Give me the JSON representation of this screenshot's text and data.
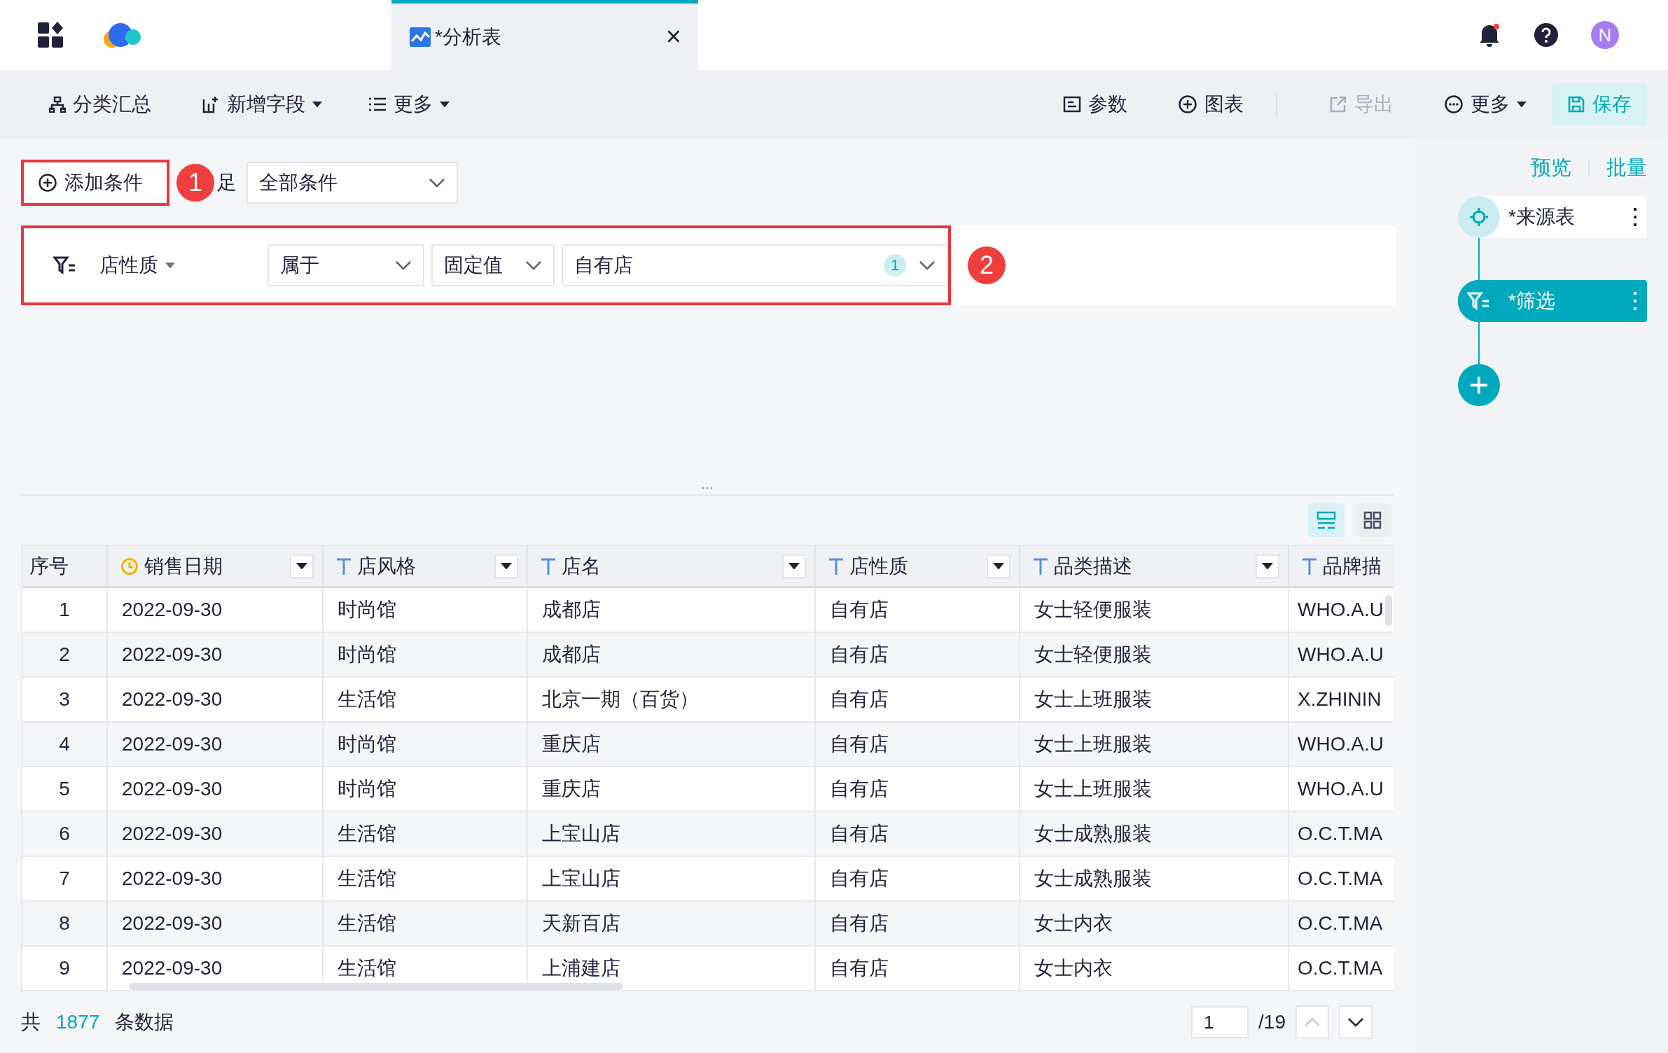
{
  "top_bar": {
    "tab": {
      "title": "*分析表",
      "close": "×",
      "selected": true
    },
    "avatar": "N"
  },
  "toolbar": {
    "left": [
      {
        "label": "分类汇总",
        "dropdown": false
      },
      {
        "label": "新增字段",
        "dropdown": true
      },
      {
        "label": "更多",
        "dropdown": true
      }
    ],
    "right": [
      {
        "label": "参数",
        "kind": "plain",
        "disabled": false,
        "dropdown": false
      },
      {
        "label": "图表",
        "kind": "plain",
        "disabled": false,
        "dropdown": false
      },
      {
        "label": "导出",
        "kind": "plain",
        "disabled": true,
        "dropdown": false
      },
      {
        "label": "更多",
        "kind": "plain",
        "disabled": false,
        "dropdown": true
      },
      {
        "label": "保存",
        "kind": "primary",
        "disabled": false,
        "dropdown": false
      }
    ]
  },
  "filter": {
    "add_button": "添加条件",
    "match_label": "足",
    "match_select": "全部条件",
    "condition": {
      "field": "店性质",
      "operator": "属于",
      "value_type": "固定值",
      "value": "自有店",
      "count": "1"
    },
    "annotations": [
      {
        "number": "1"
      },
      {
        "number": "2"
      }
    ]
  },
  "view_toggles": [
    {
      "selected": true
    },
    {
      "selected": false
    }
  ],
  "table": {
    "columns": [
      {
        "label": "序号",
        "kind": "plain"
      },
      {
        "label": "销售日期",
        "kind": "date"
      },
      {
        "label": "店风格",
        "kind": "text"
      },
      {
        "label": "店名",
        "kind": "text"
      },
      {
        "label": "店性质",
        "kind": "text"
      },
      {
        "label": "品类描述",
        "kind": "text"
      },
      {
        "label": "品牌描",
        "kind": "text"
      }
    ],
    "rows": [
      [
        "1",
        "2022-09-30",
        "时尚馆",
        "成都店",
        "自有店",
        "女士轻便服装",
        "WHO.A.U"
      ],
      [
        "2",
        "2022-09-30",
        "时尚馆",
        "成都店",
        "自有店",
        "女士轻便服装",
        "WHO.A.U"
      ],
      [
        "3",
        "2022-09-30",
        "生活馆",
        "北京一期（百货）",
        "自有店",
        "女士上班服装",
        "X.ZHININ"
      ],
      [
        "4",
        "2022-09-30",
        "时尚馆",
        "重庆店",
        "自有店",
        "女士上班服装",
        "WHO.A.U"
      ],
      [
        "5",
        "2022-09-30",
        "时尚馆",
        "重庆店",
        "自有店",
        "女士上班服装",
        "WHO.A.U"
      ],
      [
        "6",
        "2022-09-30",
        "生活馆",
        "上宝山店",
        "自有店",
        "女士成熟服装",
        "O.C.T.MA"
      ],
      [
        "7",
        "2022-09-30",
        "生活馆",
        "上宝山店",
        "自有店",
        "女士成熟服装",
        "O.C.T.MA"
      ],
      [
        "8",
        "2022-09-30",
        "生活馆",
        "天新百店",
        "自有店",
        "女士内衣",
        "O.C.T.MA"
      ],
      [
        "9",
        "2022-09-30",
        "生活馆",
        "上浦建店",
        "自有店",
        "女士内衣",
        "O.C.T.MA"
      ]
    ]
  },
  "footer": {
    "prefix": "共",
    "count": "1877",
    "suffix": "条数据",
    "page": "1",
    "pages": "/19"
  },
  "side_panel": {
    "links": [
      "预览",
      "批量"
    ],
    "nodes": [
      {
        "label": "*来源表",
        "selected": false
      },
      {
        "label": "*筛选",
        "selected": true
      }
    ]
  }
}
